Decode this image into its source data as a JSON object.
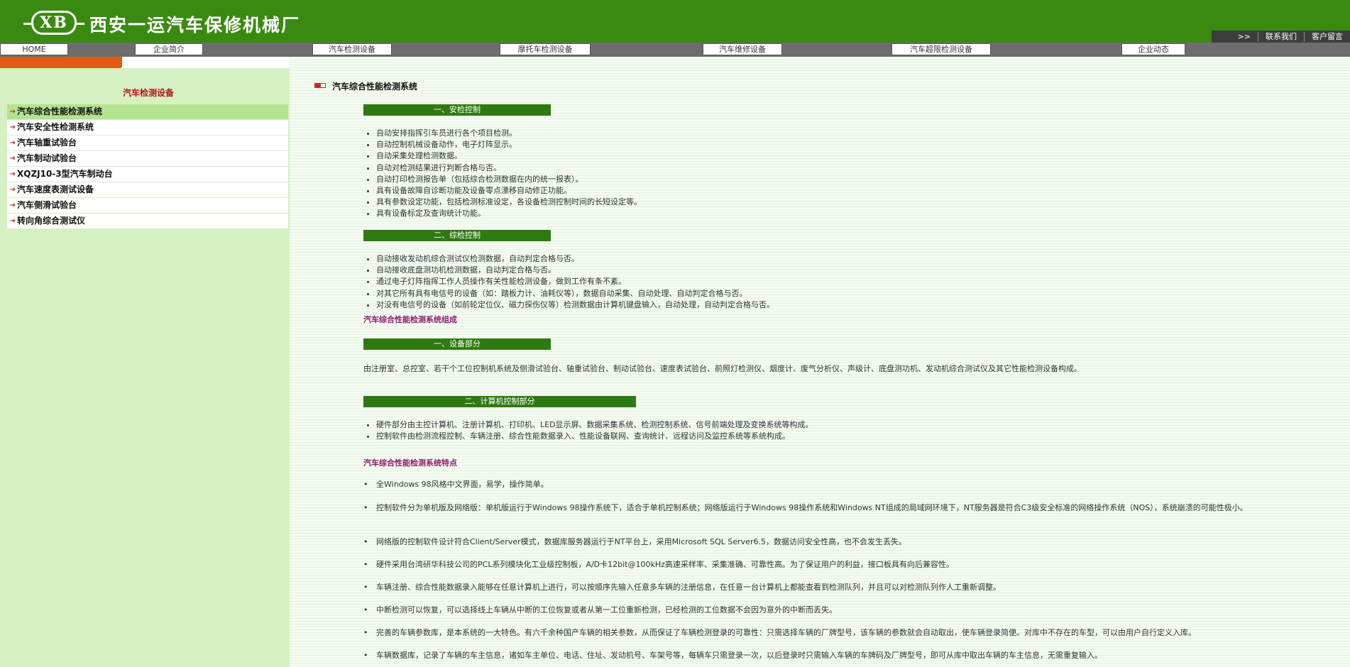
{
  "header": {
    "logo_text": "XB",
    "company_name": "西安一运汽车保修机械厂",
    "links": [
      ">>",
      "联系我们",
      "客户留言"
    ]
  },
  "nav": {
    "items": [
      "HOME",
      "企业简介",
      "汽车检测设备",
      "摩托车检测设备",
      "汽车维修设备",
      "汽车超限检测设备",
      "企业动态"
    ]
  },
  "sidebar": {
    "title": "汽车检测设备",
    "items": [
      "汽车综合性能检测系统",
      "汽车安全性检测系统",
      "汽车轴重试验台",
      "汽车制动试验台",
      "XQZJ10-3型汽车制动台",
      "汽车速度表测试设备",
      "汽车侧滑试验台",
      "转向角综合测试仪"
    ],
    "active_index": 0
  },
  "main": {
    "title": "汽车综合性能检测系统",
    "section1": {
      "title": "一、安检控制",
      "bullets": [
        "自动安排指挥引车员进行各个项目检测。",
        "自动控制机械设备动作，电子灯阵显示。",
        "自动采集处理检测数据。",
        "自动对检测结果进行判断合格与否。",
        "自动打印检测报告单（包括综合检测数据在内的统一报表）。",
        "具有设备故障自诊断功能及设备零点漂移自动修正功能。",
        "具有参数设定功能，包括检测标准设定，各设备检测控制时间的长短设定等。",
        "具有设备标定及查询统计功能。"
      ]
    },
    "section2": {
      "title": "二、综检控制",
      "bullets": [
        "自动接收发动机综合测试仪检测数据，自动判定合格与否。",
        "自动接收底盘测功机检测数据，自动判定合格与否。",
        "通过电子灯阵指挥工作人员操作有关性能检测设备，做到工作有条不紊。",
        "对其它所有具有电信号的设备（如：踏板力计、油耗仪等），数据自动采集、自动处理、自动判定合格与否。",
        "对没有电信号的设备（如前轮定位仪、磁力探伤仪等）检测数据由计算机键盘输入，自动处理，自动判定合格与否。"
      ]
    },
    "composition_heading": "汽车综合性能检测系统组成",
    "section3": {
      "title": "一、设备部分",
      "text": "由注册室、总控室、若干个工位控制机系统及侧滑试验台、轴重试验台、制动试验台、速度表试验台、前照灯检测仪、烟度计、废气分析仪、声级计、底盘测功机、发动机综合测试仪及其它性能检测设备构成。"
    },
    "section4": {
      "title": "二、计算机控制部分",
      "bullets": [
        "硬件部分由主控计算机、注册计算机、打印机、LED显示屏、数据采集系统、检测控制系统、信号前端处理及变换系统等构成。",
        "控制软件由检测流程控制、车辆注册、综合性能数据录入、性能设备联网、查询统计、远程访问及监控系统等系统构成。"
      ]
    },
    "features_heading": "汽车综合性能检测系统特点",
    "features": [
      "全Windows 98风格中文界面，易学，操作简单。",
      "控制软件分为单机版及网络版：单机版运行于Windows 98操作系统下，适合于单机控制系统；网络版运行于Windows 98操作系统和Windows NT组成的局域网环境下，NT服务器是符合C3级安全标准的网络操作系统（NOS），系统崩溃的可能性极小。",
      "网络版的控制软件设计符合Client/Server模式，数据库服务器运行于NT平台上，采用Microsoft SQL Server6.5，数据访问安全性高，也不会发生丢失。",
      "硬件采用台湾研华科技公司的PCL系列模块化工业级控制板，A/D卡12bit@100kHz高速采样率、采集准确、可靠性高。为了保证用户的利益，接口板具有向后兼容性。",
      "车辆注册、综合性能数据录入能够在任意计算机上进行，可以按顺序先输入任意多车辆的注册信息，在任意一台计算机上都能查看到检测队列，并且可以对检测队列作人工重新调整。",
      "中断检测可以恢复，可以选择线上车辆从中断的工位恢复或者从第一工位重新检测，已经检测的工位数据不会因为意外的中断而丢失。",
      "完善的车辆参数库，是本系统的一大特色。有六千余种国产车辆的相关参数，从而保证了车辆检测登录的可靠性：只需选择车辆的厂牌型号，该车辆的参数就会自动取出，使车辆登录简便。对库中不存在的车型，可以由用户自行定义入库。",
      "车辆数据库，记录了车辆的车主信息，诸如车主单位、电话、住址、发动机号、车架号等，每辆车只需登录一次，以后登录时只需输入车辆的车牌码及厂牌型号，即可从库中取出车辆的车主信息，无需重复输入。"
    ]
  },
  "colors": {
    "header_green": "#3a8a12",
    "section_bar": "#2f7a10",
    "sidebar_bg": "#d6f0c3",
    "active_item": "#b3e38e",
    "orange_strip": "#de5b14",
    "subhead_color": "#8e1d6d",
    "sidebar_title_color": "#b3171b"
  }
}
